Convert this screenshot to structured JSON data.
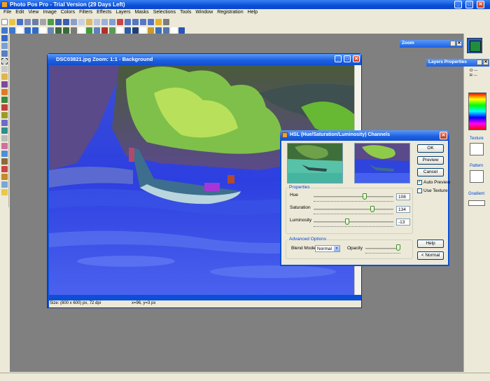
{
  "app": {
    "title": "Photo Pos Pro - Trial Version (29 Days Left)",
    "min": "_",
    "max": "□",
    "close": "✕"
  },
  "menu": [
    "File",
    "Edit",
    "View",
    "Image",
    "Colors",
    "Filters",
    "Effects",
    "Layers",
    "Masks",
    "Selections",
    "Tools",
    "Window",
    "Registration",
    "Help"
  ],
  "doc": {
    "title": "DSC03821.jpg  Zoom: 1:1 - Background",
    "size_status": "Size: (800 x 600) px, 72 dpi",
    "coord_status": "x=96, y=3 px"
  },
  "panels": {
    "zoom_title": "Zoom",
    "layers_title": "Layers Properties",
    "layer_o": "O ---",
    "layer_r": "R ---",
    "texture": "Texture",
    "pattern": "Pattern",
    "gradient": "Gradient",
    "fg_color": "#1e8e3e",
    "bg_color": "#2060d0"
  },
  "dialog": {
    "title": "HSL (Hue/Saturation/Luminosity) Channels",
    "ok": "OK",
    "preview": "Preview",
    "cancel": "Cancel",
    "auto_preview": "Auto Preview",
    "use_texture": "Use Texture",
    "properties": "Properties",
    "hue_label": "Hue",
    "hue_value": "108",
    "saturation_label": "Saturation",
    "saturation_value": "134",
    "luminosity_label": "Luminosity",
    "luminosity_value": "-13",
    "advanced": "Advanced Options",
    "blend_label": "Blend Mode",
    "blend_value": "Normal",
    "opacity_label": "Opacity",
    "help": "Help",
    "normal": "< Normal",
    "auto_preview_checked": true,
    "use_texture_checked": false,
    "hue_level": 0.65,
    "saturation_level": 0.75,
    "luminosity_level": 0.42,
    "opacity_level": 1.0
  }
}
